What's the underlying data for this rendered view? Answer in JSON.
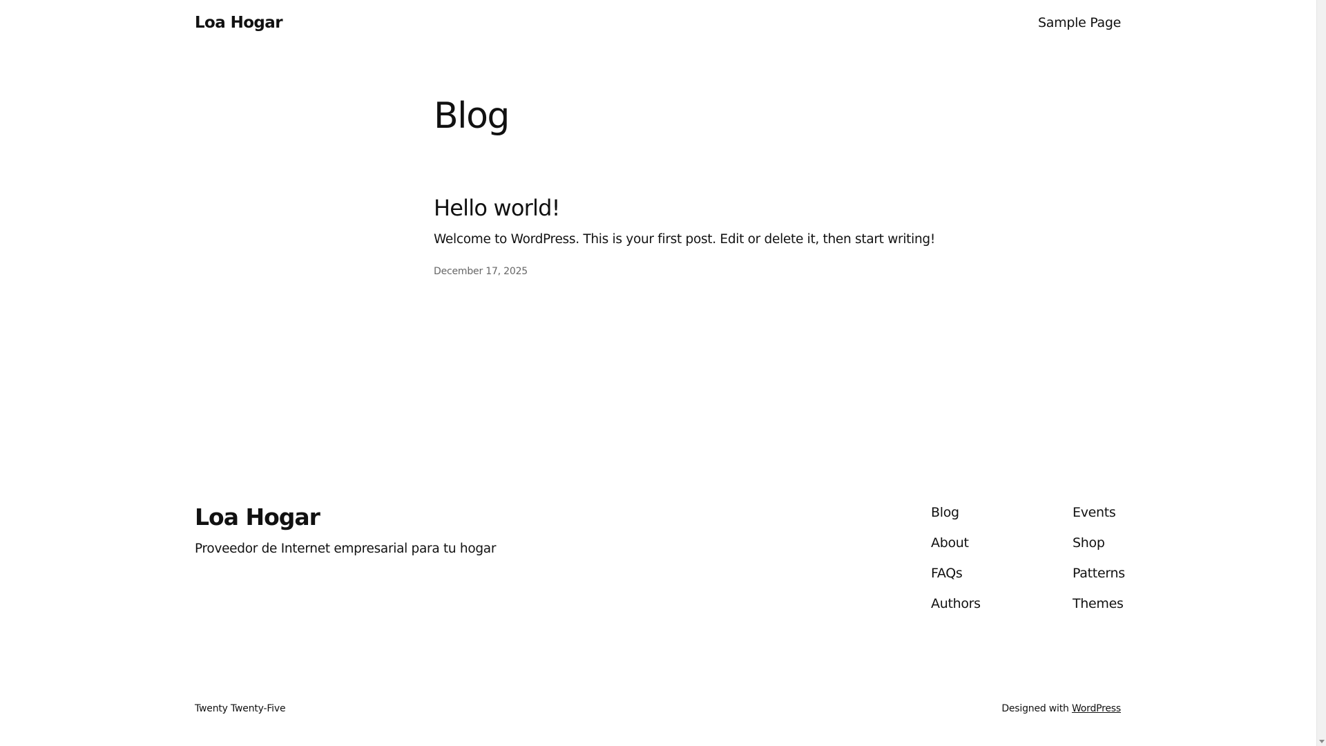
{
  "header": {
    "site_title": "Loa Hogar",
    "nav_items": [
      {
        "label": "Sample Page"
      }
    ]
  },
  "main": {
    "heading": "Blog",
    "posts": [
      {
        "title": "Hello world!",
        "excerpt": "Welcome to WordPress. This is your first post. Edit or delete it, then start writing!",
        "date": "December 17, 2025"
      }
    ]
  },
  "footer": {
    "site_title": "Loa Hogar",
    "tagline": "Proveedor de Internet empresarial para tu hogar",
    "nav_col1": [
      "Blog",
      "About",
      "FAQs",
      "Authors"
    ],
    "nav_col2": [
      "Events",
      "Shop",
      "Patterns",
      "Themes"
    ],
    "theme_credit": "Twenty Twenty-Five",
    "designed_prefix": "Designed with",
    "designed_link": "WordPress"
  },
  "colors": {
    "text": "#111111",
    "muted": "#666666",
    "background": "#ffffff"
  }
}
